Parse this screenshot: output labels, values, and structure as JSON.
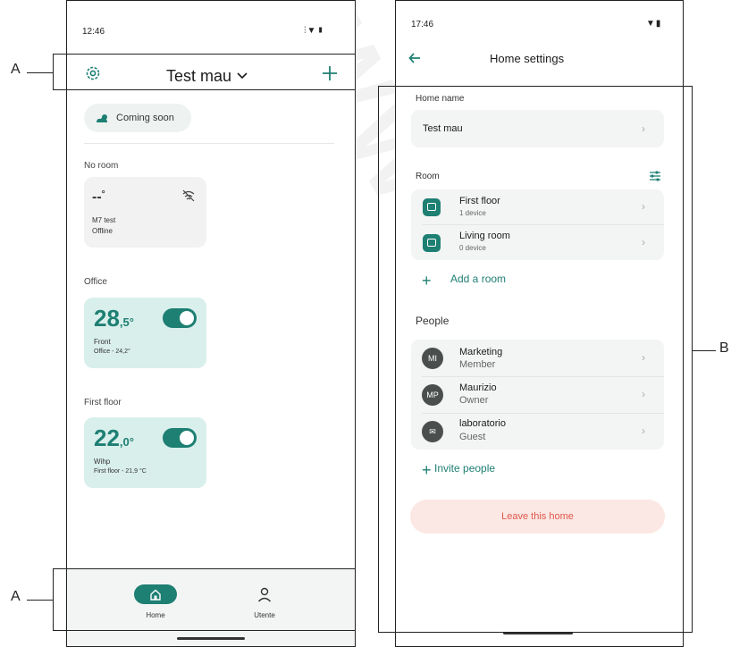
{
  "callouts": {
    "a_top": "A",
    "a_bottom": "A",
    "b": "B"
  },
  "left_screen": {
    "status": {
      "time": "12:46",
      "icons": "⫶▼▮"
    },
    "header": {
      "home_name": "Test mau",
      "settings_icon": "gear-icon",
      "add_icon": "plus-icon"
    },
    "weather_chip": {
      "label": "Coming soon",
      "icon": "weather-icon"
    },
    "sections": [
      {
        "title": "No room",
        "device": {
          "temp": "--",
          "unit": "°",
          "name": "M7 test",
          "status": "Offline",
          "icon": "wifi-off-icon"
        }
      },
      {
        "title": "Office",
        "device": {
          "temp": "28",
          "unit": ",5°",
          "name": "Front",
          "status": "Office - 24,2°"
        }
      },
      {
        "title": "First floor",
        "device": {
          "temp": "22",
          "unit": ",0°",
          "name": "Wihp",
          "status": "First floor - 21,9 °C"
        }
      }
    ],
    "nav": {
      "home_label": "Home",
      "user_label": "Utente",
      "home_icon": "home-icon",
      "user_icon": "person-icon"
    }
  },
  "right_screen": {
    "status": {
      "time": "17:46",
      "icons": "▼▮"
    },
    "header": {
      "title": "Home settings",
      "back_icon": "arrow-left-icon"
    },
    "home_name": {
      "label": "Home name",
      "value": "Test mau"
    },
    "rooms": {
      "label": "Room",
      "items": [
        {
          "name": "First floor",
          "devices": "1 device"
        },
        {
          "name": "Living room",
          "devices": "0 device"
        }
      ],
      "add_label": "Add a room"
    },
    "people": {
      "label": "People",
      "items": [
        {
          "initials": "MI",
          "name": "Marketing",
          "role": "Member"
        },
        {
          "initials": "MP",
          "name": "Maurizio",
          "role": "Owner"
        },
        {
          "initials": "✉",
          "name": "laboratorio",
          "role": "Guest"
        }
      ],
      "invite_label": "Invite people"
    },
    "leave_label": "Leave this home"
  },
  "colors": {
    "accent": "#1e7f73",
    "card_green": "#d9efeb",
    "danger": "#e2574c",
    "danger_bg": "#fbe7e3"
  }
}
